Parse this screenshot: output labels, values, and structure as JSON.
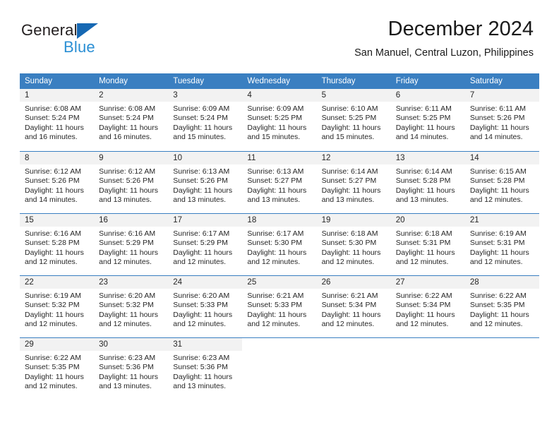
{
  "logo": {
    "word_top": "General",
    "word_bottom": "Blue",
    "triangle_icon": "blue-triangle-icon",
    "color_dark": "#231f20",
    "color_blue": "#2b8fd4"
  },
  "header": {
    "title": "December 2024",
    "subtitle": "San Manuel, Central Luzon, Philippines"
  },
  "colors": {
    "header_blue": "#3a7fc1",
    "day_number_band": "#f2f2f2",
    "text": "#262626"
  },
  "calendar": {
    "weekdays": [
      "Sunday",
      "Monday",
      "Tuesday",
      "Wednesday",
      "Thursday",
      "Friday",
      "Saturday"
    ],
    "weeks": [
      [
        {
          "day": "1",
          "sunrise": "Sunrise: 6:08 AM",
          "sunset": "Sunset: 5:24 PM",
          "daylight": "Daylight: 11 hours and 16 minutes."
        },
        {
          "day": "2",
          "sunrise": "Sunrise: 6:08 AM",
          "sunset": "Sunset: 5:24 PM",
          "daylight": "Daylight: 11 hours and 16 minutes."
        },
        {
          "day": "3",
          "sunrise": "Sunrise: 6:09 AM",
          "sunset": "Sunset: 5:24 PM",
          "daylight": "Daylight: 11 hours and 15 minutes."
        },
        {
          "day": "4",
          "sunrise": "Sunrise: 6:09 AM",
          "sunset": "Sunset: 5:25 PM",
          "daylight": "Daylight: 11 hours and 15 minutes."
        },
        {
          "day": "5",
          "sunrise": "Sunrise: 6:10 AM",
          "sunset": "Sunset: 5:25 PM",
          "daylight": "Daylight: 11 hours and 15 minutes."
        },
        {
          "day": "6",
          "sunrise": "Sunrise: 6:11 AM",
          "sunset": "Sunset: 5:25 PM",
          "daylight": "Daylight: 11 hours and 14 minutes."
        },
        {
          "day": "7",
          "sunrise": "Sunrise: 6:11 AM",
          "sunset": "Sunset: 5:26 PM",
          "daylight": "Daylight: 11 hours and 14 minutes."
        }
      ],
      [
        {
          "day": "8",
          "sunrise": "Sunrise: 6:12 AM",
          "sunset": "Sunset: 5:26 PM",
          "daylight": "Daylight: 11 hours and 14 minutes."
        },
        {
          "day": "9",
          "sunrise": "Sunrise: 6:12 AM",
          "sunset": "Sunset: 5:26 PM",
          "daylight": "Daylight: 11 hours and 13 minutes."
        },
        {
          "day": "10",
          "sunrise": "Sunrise: 6:13 AM",
          "sunset": "Sunset: 5:26 PM",
          "daylight": "Daylight: 11 hours and 13 minutes."
        },
        {
          "day": "11",
          "sunrise": "Sunrise: 6:13 AM",
          "sunset": "Sunset: 5:27 PM",
          "daylight": "Daylight: 11 hours and 13 minutes."
        },
        {
          "day": "12",
          "sunrise": "Sunrise: 6:14 AM",
          "sunset": "Sunset: 5:27 PM",
          "daylight": "Daylight: 11 hours and 13 minutes."
        },
        {
          "day": "13",
          "sunrise": "Sunrise: 6:14 AM",
          "sunset": "Sunset: 5:28 PM",
          "daylight": "Daylight: 11 hours and 13 minutes."
        },
        {
          "day": "14",
          "sunrise": "Sunrise: 6:15 AM",
          "sunset": "Sunset: 5:28 PM",
          "daylight": "Daylight: 11 hours and 12 minutes."
        }
      ],
      [
        {
          "day": "15",
          "sunrise": "Sunrise: 6:16 AM",
          "sunset": "Sunset: 5:28 PM",
          "daylight": "Daylight: 11 hours and 12 minutes."
        },
        {
          "day": "16",
          "sunrise": "Sunrise: 6:16 AM",
          "sunset": "Sunset: 5:29 PM",
          "daylight": "Daylight: 11 hours and 12 minutes."
        },
        {
          "day": "17",
          "sunrise": "Sunrise: 6:17 AM",
          "sunset": "Sunset: 5:29 PM",
          "daylight": "Daylight: 11 hours and 12 minutes."
        },
        {
          "day": "18",
          "sunrise": "Sunrise: 6:17 AM",
          "sunset": "Sunset: 5:30 PM",
          "daylight": "Daylight: 11 hours and 12 minutes."
        },
        {
          "day": "19",
          "sunrise": "Sunrise: 6:18 AM",
          "sunset": "Sunset: 5:30 PM",
          "daylight": "Daylight: 11 hours and 12 minutes."
        },
        {
          "day": "20",
          "sunrise": "Sunrise: 6:18 AM",
          "sunset": "Sunset: 5:31 PM",
          "daylight": "Daylight: 11 hours and 12 minutes."
        },
        {
          "day": "21",
          "sunrise": "Sunrise: 6:19 AM",
          "sunset": "Sunset: 5:31 PM",
          "daylight": "Daylight: 11 hours and 12 minutes."
        }
      ],
      [
        {
          "day": "22",
          "sunrise": "Sunrise: 6:19 AM",
          "sunset": "Sunset: 5:32 PM",
          "daylight": "Daylight: 11 hours and 12 minutes."
        },
        {
          "day": "23",
          "sunrise": "Sunrise: 6:20 AM",
          "sunset": "Sunset: 5:32 PM",
          "daylight": "Daylight: 11 hours and 12 minutes."
        },
        {
          "day": "24",
          "sunrise": "Sunrise: 6:20 AM",
          "sunset": "Sunset: 5:33 PM",
          "daylight": "Daylight: 11 hours and 12 minutes."
        },
        {
          "day": "25",
          "sunrise": "Sunrise: 6:21 AM",
          "sunset": "Sunset: 5:33 PM",
          "daylight": "Daylight: 11 hours and 12 minutes."
        },
        {
          "day": "26",
          "sunrise": "Sunrise: 6:21 AM",
          "sunset": "Sunset: 5:34 PM",
          "daylight": "Daylight: 11 hours and 12 minutes."
        },
        {
          "day": "27",
          "sunrise": "Sunrise: 6:22 AM",
          "sunset": "Sunset: 5:34 PM",
          "daylight": "Daylight: 11 hours and 12 minutes."
        },
        {
          "day": "28",
          "sunrise": "Sunrise: 6:22 AM",
          "sunset": "Sunset: 5:35 PM",
          "daylight": "Daylight: 11 hours and 12 minutes."
        }
      ],
      [
        {
          "day": "29",
          "sunrise": "Sunrise: 6:22 AM",
          "sunset": "Sunset: 5:35 PM",
          "daylight": "Daylight: 11 hours and 12 minutes."
        },
        {
          "day": "30",
          "sunrise": "Sunrise: 6:23 AM",
          "sunset": "Sunset: 5:36 PM",
          "daylight": "Daylight: 11 hours and 13 minutes."
        },
        {
          "day": "31",
          "sunrise": "Sunrise: 6:23 AM",
          "sunset": "Sunset: 5:36 PM",
          "daylight": "Daylight: 11 hours and 13 minutes."
        },
        {
          "day": "",
          "sunrise": "",
          "sunset": "",
          "daylight": ""
        },
        {
          "day": "",
          "sunrise": "",
          "sunset": "",
          "daylight": ""
        },
        {
          "day": "",
          "sunrise": "",
          "sunset": "",
          "daylight": ""
        },
        {
          "day": "",
          "sunrise": "",
          "sunset": "",
          "daylight": ""
        }
      ]
    ]
  }
}
